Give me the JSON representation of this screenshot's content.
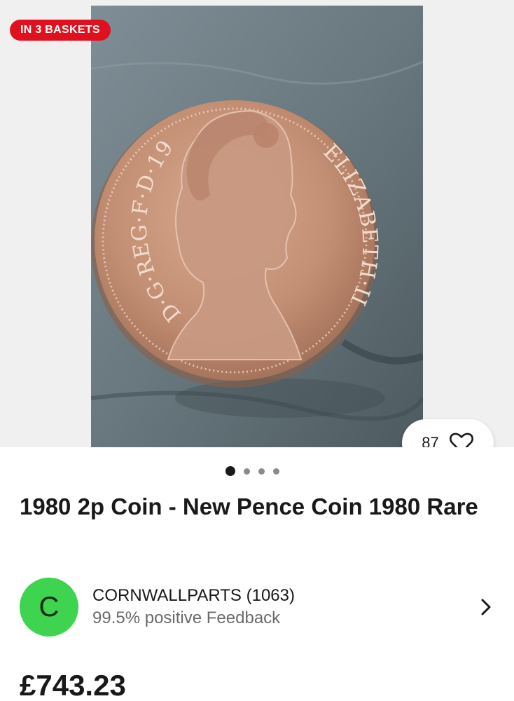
{
  "gallery": {
    "badge": "IN 3 BASKETS",
    "watch_count": "87",
    "photo_icon": "coin-photo",
    "heart_icon": "heart-outline-icon",
    "slide_count": 4,
    "active_slide": 1
  },
  "coin": {
    "inscription_left": "D·G·REG·F·D·1980",
    "inscription_right": "ELIZABETH·II"
  },
  "listing": {
    "title": "1980 2p Coin - New Pence Coin 1980 Rare",
    "price": "£743.23"
  },
  "seller": {
    "initial": "C",
    "name": "CORNWALLPARTS (1063)",
    "feedback": "99.5% positive Feedback",
    "chevron_icon": "chevron-right-icon"
  },
  "colors": {
    "badge": "#e0101e",
    "avatar": "#3fd44f",
    "gallery_bg": "#f0f0f0",
    "text": "#191919",
    "muted_text": "#6a6a6a"
  }
}
